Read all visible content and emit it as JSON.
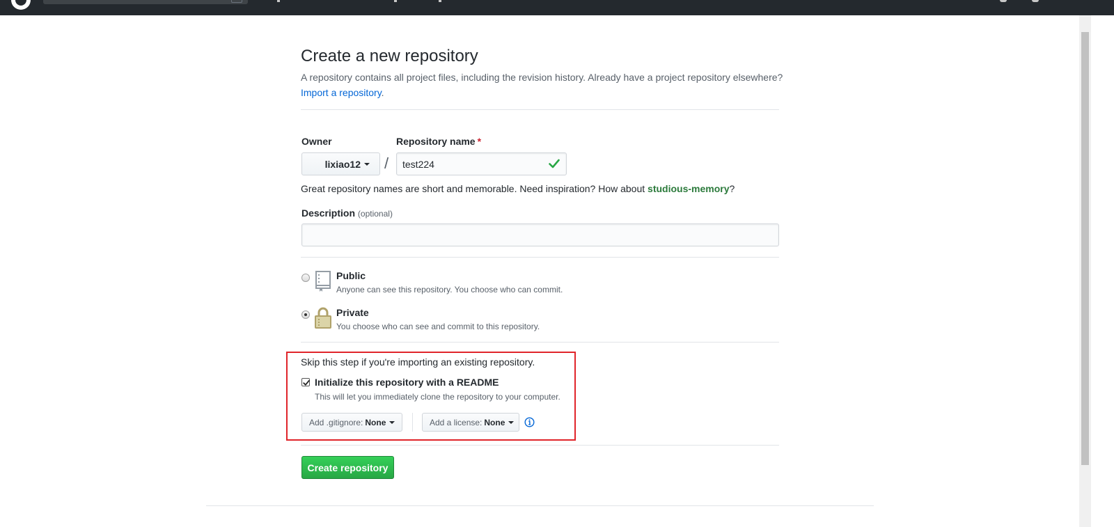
{
  "page": {
    "title": "Create a new repository",
    "subtitle": "A repository contains all project files, including the revision history. Already have a project repository elsewhere?",
    "import_link": "Import a repository",
    "import_suffix": "."
  },
  "owner": {
    "label": "Owner",
    "value": "lixiao12"
  },
  "repo_name": {
    "label": "Repository name",
    "required_mark": "*",
    "value": "test224",
    "separator": "/"
  },
  "hint": {
    "prefix": "Great repository names are short and memorable. Need inspiration? How about ",
    "suggestion": "studious-memory",
    "suffix": "?"
  },
  "description": {
    "label": "Description",
    "optional": "(optional)",
    "value": ""
  },
  "visibility": {
    "public": {
      "title": "Public",
      "desc": "Anyone can see this repository. You choose who can commit.",
      "selected": false
    },
    "private": {
      "title": "Private",
      "desc": "You choose who can see and commit to this repository.",
      "selected": true
    }
  },
  "init": {
    "skip_text": "Skip this step if you're importing an existing repository.",
    "readme_label": "Initialize this repository with a README",
    "readme_desc": "This will let you immediately clone the repository to your computer.",
    "readme_checked": true
  },
  "gitignore": {
    "label": "Add .gitignore:",
    "value": "None"
  },
  "license": {
    "label": "Add a license:",
    "value": "None"
  },
  "create_button": "Create repository",
  "colors": {
    "header_bg": "#24292e",
    "link": "#0366d6",
    "primary_green": "#28a745",
    "highlight_red": "#e0242a",
    "required_red": "#cb2431",
    "check_green": "#28a745"
  },
  "icons": {
    "public": "repo-book-icon",
    "private": "lock-icon",
    "valid": "check-icon",
    "info": "info-icon"
  }
}
